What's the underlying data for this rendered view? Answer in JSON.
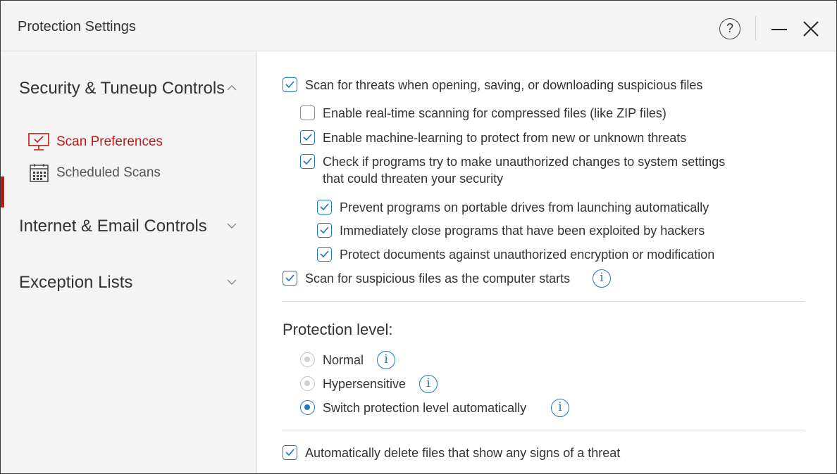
{
  "window": {
    "title": "Protection Settings",
    "help_glyph": "?",
    "minimize_icon": "minimize-icon",
    "close_icon": "close-icon"
  },
  "sidebar": {
    "groups": [
      {
        "label": "Security & Tuneup Controls",
        "expanded": true
      },
      {
        "label": "Internet & Email Controls",
        "expanded": false
      },
      {
        "label": "Exception Lists",
        "expanded": false
      }
    ],
    "items": [
      {
        "label": "Scan Preferences",
        "icon": "monitor-check-icon",
        "active": true
      },
      {
        "label": "Scheduled Scans",
        "icon": "calendar-icon",
        "active": false
      }
    ]
  },
  "main": {
    "options": [
      {
        "label": "Scan for threats when opening, saving, or downloading suspicious files",
        "checked": true
      },
      {
        "label": "Enable real-time scanning for compressed files (like ZIP files)",
        "checked": false
      },
      {
        "label": "Enable machine-learning to protect from new or unknown threats",
        "checked": true
      },
      {
        "label": "Check if programs try to make unauthorized changes to system settings",
        "label2": "that could threaten your security",
        "checked": true
      },
      {
        "label": "Prevent programs on portable drives from launching automatically",
        "checked": true
      },
      {
        "label": "Immediately close programs that have been exploited by hackers",
        "checked": true
      },
      {
        "label": "Protect documents against unauthorized encryption or modification",
        "checked": true
      },
      {
        "label": "Scan for suspicious files as the computer starts",
        "checked": true,
        "info": true
      }
    ],
    "protection_level": {
      "title": "Protection level:",
      "options": [
        {
          "label": "Normal",
          "selected": false
        },
        {
          "label": "Hypersensitive",
          "selected": false
        },
        {
          "label": "Switch protection level automatically",
          "selected": true
        }
      ]
    },
    "auto_delete": {
      "label": "Automatically delete files that show any signs of a threat",
      "checked": true
    },
    "info_glyph": "i"
  },
  "colors": {
    "accent": "#1f78c8",
    "active_nav": "#c01818",
    "sidebar_bg": "#f4f4f4"
  }
}
